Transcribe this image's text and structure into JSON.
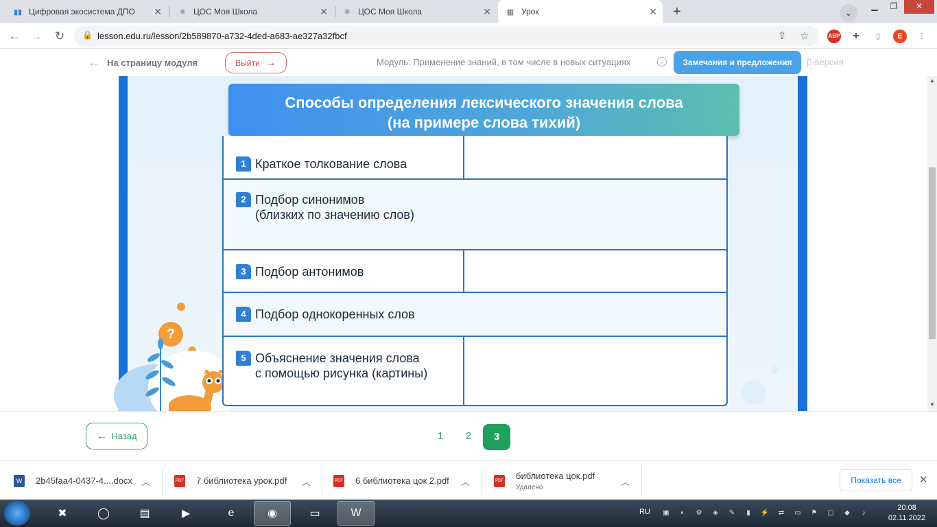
{
  "browser": {
    "tabs": [
      {
        "title": "Цифровая экосистема ДПО",
        "icon": "book-icon"
      },
      {
        "title": "ЦОС Моя Школа",
        "icon": "atom-icon"
      },
      {
        "title": "ЦОС Моя Школа",
        "icon": "atom-icon"
      },
      {
        "title": "Урок",
        "icon": "layout-icon"
      }
    ],
    "new_tab": "+",
    "url": "lesson.edu.ru/lesson/2b589870-a732-4ded-a683-ae327a32fbcf",
    "profile_initial": "E",
    "adblock_label": "ABP"
  },
  "header": {
    "back_label": "На страницу модуля",
    "exit_label": "Выйти",
    "module_label": "Модуль: Применение знаний, в том числе в новых ситуациях",
    "info": "i",
    "feedback_label": "Замечания и предложения",
    "beta_label": "β-версия"
  },
  "slide": {
    "title_line1": "Способы определения лексического значения слова",
    "title_line2": "(на примере слова тихий)",
    "bubble": "?",
    "rows": [
      {
        "num": "1",
        "text": "Краткое толкование слова"
      },
      {
        "num": "2",
        "text": "Подбор синонимов\n(близких по значению слов)"
      },
      {
        "num": "3",
        "text": "Подбор антонимов"
      },
      {
        "num": "4",
        "text": "Подбор однокоренных слов"
      },
      {
        "num": "5",
        "text": "Объяснение значения слова\nс помощью рисунка (картины)"
      }
    ]
  },
  "pagination": {
    "back_label": "Назад",
    "pages": [
      "1",
      "2",
      "3"
    ],
    "current": "3"
  },
  "downloads": {
    "items": [
      {
        "name": "2b45faa4-0437-4....docx",
        "sub": "",
        "type": "W"
      },
      {
        "name": "7 библиотека урок.pdf",
        "sub": "",
        "type": "PDF"
      },
      {
        "name": "6 библиотека цок 2.pdf",
        "sub": "",
        "type": "PDF"
      },
      {
        "name": "библиотека цок.pdf",
        "sub": "Удалено",
        "type": "PDF"
      }
    ],
    "show_all": "Показать все"
  },
  "taskbar": {
    "lang": "RU",
    "time": "20:08",
    "date": "02.11.2022"
  },
  "colors": {
    "slide_border": "#1971d8",
    "table_border": "#2d73c6",
    "feedback_bg": "#4aa3e8",
    "page_active": "#20a05d",
    "exit_border": "#c8736f"
  }
}
